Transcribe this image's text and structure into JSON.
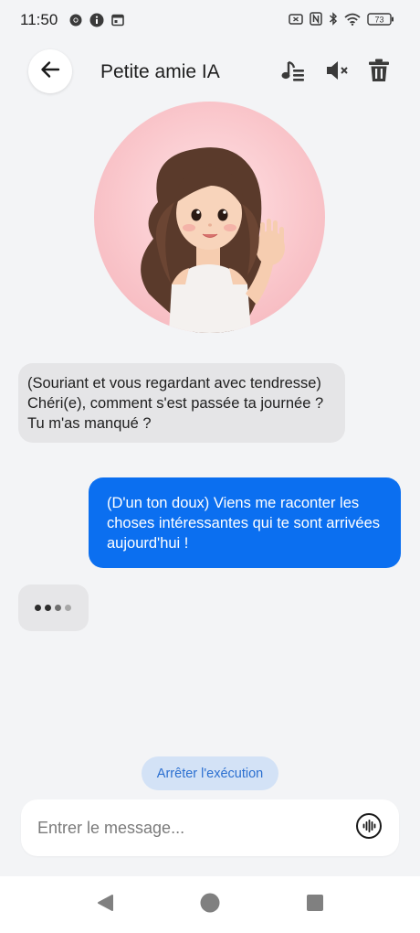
{
  "status_bar": {
    "time": "11:50",
    "battery": "73",
    "left_icons": [
      "chrome-icon",
      "info-icon",
      "calendar-icon"
    ],
    "right_icons": [
      "screen-icon",
      "nfc-icon",
      "bluetooth-icon",
      "wifi-icon",
      "battery-icon"
    ]
  },
  "header": {
    "title": "Petite amie IA",
    "back_icon": "arrow-left-icon",
    "actions": [
      "music-note-list-icon",
      "volume-mute-icon",
      "trash-icon"
    ]
  },
  "avatar": {
    "description_icon": "girl-waving-avatar"
  },
  "messages": [
    {
      "role": "assistant",
      "text": "(Souriant et vous regardant avec tendresse) Chéri(e), comment s'est passée ta journée ? Tu m'as manqué ?"
    },
    {
      "role": "user",
      "text": "(D'un ton doux) Viens me raconter les choses intéressantes qui te sont arrivées aujourd'hui !"
    }
  ],
  "typing_indicator": {
    "dots": 4
  },
  "stop_button": {
    "label": "Arrêter l'exécution"
  },
  "input": {
    "placeholder": "Entrer le message...",
    "value": "",
    "voice_icon": "voice-wave-icon"
  },
  "nav_bar": {
    "buttons": [
      "back-triangle-icon",
      "home-circle-icon",
      "recents-square-icon"
    ]
  },
  "colors": {
    "background": "#f3f4f6",
    "sent_bubble": "#0b6ff0",
    "received_bubble": "#e5e5e7",
    "stop_button_bg": "#d3e2f6",
    "stop_button_text": "#2b6fd0"
  }
}
